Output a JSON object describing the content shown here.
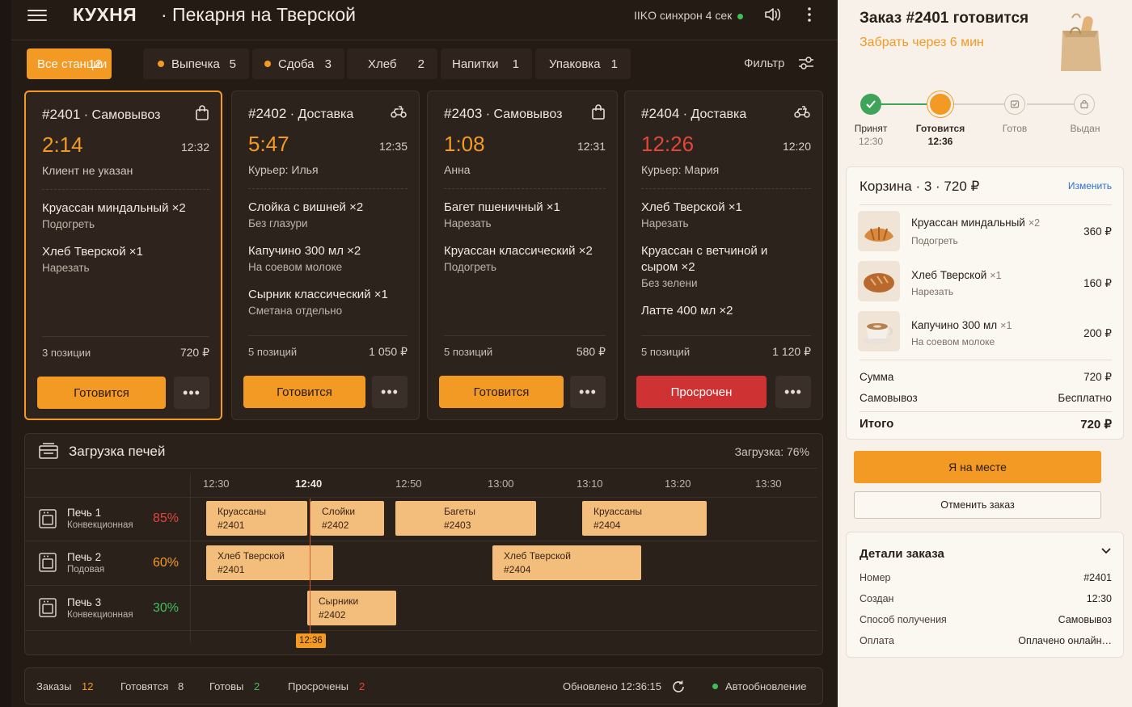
{
  "topbar": {
    "title": "КУХНЯ",
    "bakery": "· Пекарня на Тверской",
    "sync": "IIKO синхрон 4 сек"
  },
  "filters": {
    "label": "Фильтр",
    "chips": [
      {
        "label": "Все станции",
        "count": "12"
      },
      {
        "label": "Выпечка",
        "count": "5"
      },
      {
        "label": "Сдоба",
        "count": "3"
      },
      {
        "label": "Хлеб",
        "count": "2"
      },
      {
        "label": "Напитки",
        "count": "1"
      },
      {
        "label": "Упаковка",
        "count": "1"
      }
    ]
  },
  "orders": [
    {
      "id": "#2401",
      "type": "Самовывоз",
      "icon": "bag-icon",
      "timer": "2:14",
      "time": "12:32",
      "client": "Клиент не указан",
      "items": [
        {
          "name": "Круассан миндальный  ×2",
          "note": "Подогреть"
        },
        {
          "name": "Хлеб Тверской  ×1",
          "note": "Нарезать"
        }
      ],
      "positions": "3 позиции",
      "sum": "720 ₽",
      "action": "Готовится",
      "more": "•••"
    },
    {
      "id": "#2402",
      "type": "Доставка",
      "icon": "scooter-icon",
      "timer": "5:47",
      "time": "12:35",
      "client": "Курьер: Илья",
      "items": [
        {
          "name": "Слойка с вишней  ×2",
          "note": "Без глазури"
        },
        {
          "name": "Капучино 300 мл  ×2",
          "note": "На соевом молоке"
        },
        {
          "name": "Сырник классический  ×1",
          "note": "Сметана отдельно"
        }
      ],
      "positions": "5 позиций",
      "sum": "1 050 ₽",
      "action": "Готовится",
      "more": "•••"
    },
    {
      "id": "#2403",
      "type": "Самовывоз",
      "icon": "bag-icon",
      "timer": "1:08",
      "time": "12:31",
      "client": "Анна",
      "items": [
        {
          "name": "Багет пшеничный  ×1",
          "note": "Нарезать"
        },
        {
          "name": "Круассан классический  ×2",
          "note": "Подогреть"
        }
      ],
      "positions": "5 позиций",
      "sum": "580 ₽",
      "action": "Готовится",
      "more": "•••"
    },
    {
      "id": "#2404",
      "type": "Доставка",
      "icon": "scooter-icon",
      "timer": "12:26",
      "time": "12:20",
      "client": "Курьер: Мария",
      "items": [
        {
          "name": "Хлеб Тверской  ×1",
          "note": "Нарезать"
        },
        {
          "name": "Круассан с ветчиной и сыром  ×2",
          "note": "Без зелени"
        },
        {
          "name": "Латте 400 мл  ×2",
          "note": ""
        }
      ],
      "positions": "5 позиций",
      "sum": "1 120 ₽",
      "action": "Просрочен",
      "more": "•••"
    }
  ],
  "ovens": {
    "title": "Загрузка печей",
    "load": "Загрузка: 76%",
    "ticks": [
      "12:30",
      "12:40",
      "12:50",
      "13:00",
      "13:10",
      "13:20",
      "13:30"
    ],
    "now": "12:36",
    "rows": [
      {
        "name": "Печь 1",
        "type": "Конвекционная",
        "pct": "85%",
        "color": "#e2453a"
      },
      {
        "name": "Печь 2",
        "type": "Подовая",
        "pct": "60%",
        "color": "#f39a25"
      },
      {
        "name": "Печь 3",
        "type": "Конвекционная",
        "pct": "30%",
        "color": "#3fbf5a"
      }
    ],
    "bars": [
      {
        "l1": "Круассаны",
        "l2": "#2401"
      },
      {
        "l1": "Слойки",
        "l2": "#2402"
      },
      {
        "l1": "Багеты",
        "l2": "#2403"
      },
      {
        "l1": "Круассаны",
        "l2": "#2404"
      },
      {
        "l1": "Хлеб Тверской",
        "l2": "#2401"
      },
      {
        "l1": "Хлеб Тверской",
        "l2": "#2404"
      },
      {
        "l1": "Сырники",
        "l2": "#2402"
      }
    ]
  },
  "footer": {
    "orders_label": "Заказы",
    "orders": "12",
    "cooking_label": "Готовятся",
    "cooking": "8",
    "ready_label": "Готовы",
    "ready": "2",
    "late_label": "Просрочены",
    "late": "2",
    "updated": "Обновлено 12:36:15",
    "auto": "Автообновление"
  },
  "side": {
    "title": "Заказ #2401 готовится",
    "pickup": "Забрать через 6 мин",
    "steps": [
      {
        "label": "Принят",
        "time": "12:30"
      },
      {
        "label": "Готовится",
        "time": "12:36"
      },
      {
        "label": "Готов",
        "time": ""
      },
      {
        "label": "Выдан",
        "time": ""
      }
    ],
    "cart": {
      "title": "Корзина · 3 · 720 ₽",
      "edit": "Изменить",
      "items": [
        {
          "name": "Круассан миндальный",
          "qty": "×2",
          "note": "Подогреть",
          "price": "360 ₽",
          "icon": "croissant-icon"
        },
        {
          "name": "Хлеб Тверской",
          "qty": "×1",
          "note": "Нарезать",
          "price": "160 ₽",
          "icon": "bread-icon"
        },
        {
          "name": "Капучино 300 мл",
          "qty": "×1",
          "note": "На соевом молоке",
          "price": "200 ₽",
          "icon": "coffee-icon"
        }
      ],
      "sum_label": "Сумма",
      "sum": "720 ₽",
      "pickup_label": "Самовывоз",
      "pickup": "Бесплатно",
      "total_label": "Итого",
      "total": "720 ₽"
    },
    "arrived": "Я на месте",
    "cancel": "Отменить заказ",
    "details": {
      "title": "Детали заказа",
      "rows": [
        {
          "k": "Номер",
          "v": "#2401"
        },
        {
          "k": "Создан",
          "v": "12:30"
        },
        {
          "k": "Способ получения",
          "v": "Самовывоз"
        },
        {
          "k": "Оплата",
          "v": "Оплачено онлайн…"
        }
      ]
    }
  },
  "colors": {
    "accent": "#f39a25",
    "danger": "#cf3232",
    "ok": "#3fbf5a",
    "bg": "#241b15"
  }
}
